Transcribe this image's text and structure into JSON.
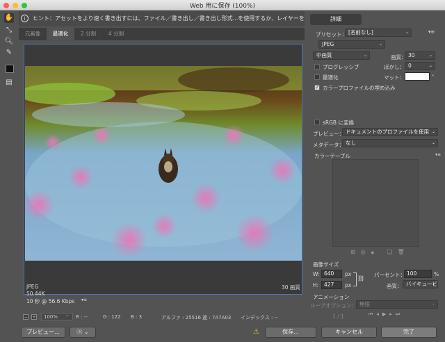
{
  "window": {
    "title": "Web 用に保存 (100%)"
  },
  "hint": "ヒント：アセットをより速く書き出すには、ファイル／書き出し／書き出し形式...を使用するか、レイヤーを右クリックして使用。",
  "tabs": [
    "元画像",
    "最適化",
    "2 分割",
    "4 分割"
  ],
  "preview_info": {
    "format": "JPEG",
    "size": "50.44K",
    "time": "10 秒 @ 56.6 Kbps",
    "quality": "30 画質"
  },
  "status": {
    "zoom": "100%",
    "r": "R : --",
    "g": "G : 122",
    "b": "B : 3",
    "alpha": "アルファ : 255",
    "hex": "16 進 : 7A7A03",
    "index": "インデックス : --"
  },
  "buttons": {
    "preview": "プレビュー...",
    "save": "保存...",
    "cancel": "キャンセル",
    "done": "完了",
    "detail": "詳細"
  },
  "settings": {
    "preset_label": "プリセット：",
    "preset_value": "[名前なし]",
    "format": "JPEG",
    "quality_level": "中画質",
    "quality_label": "画質：",
    "quality_value": "30",
    "progressive": "プログレッシブ",
    "blur_label": "ぼかし：",
    "blur_value": "0",
    "optimize": "最適化",
    "matte_label": "マット：",
    "embed_profile": "カラープロファイルの埋め込み",
    "srgb": "sRGB に変換",
    "preview_label": "プレビュー：",
    "preview_value": "ドキュメントのプロファイルを使用",
    "metadata_label": "メタデータ：",
    "metadata_value": "なし",
    "color_table": "カラーテーブル"
  },
  "image_size": {
    "heading": "画像サイズ",
    "w_label": "W:",
    "w_value": "640",
    "h_label": "H:",
    "h_value": "427",
    "unit": "px",
    "percent_label": "パーセント：",
    "percent_value": "100",
    "percent_unit": "%",
    "quality_label": "画質：",
    "quality_value": "バイキュービック法"
  },
  "animation": {
    "heading": "アニメーション",
    "loop_label": "ループオプション：",
    "loop_value": "無限",
    "frame": "1 / 1"
  }
}
